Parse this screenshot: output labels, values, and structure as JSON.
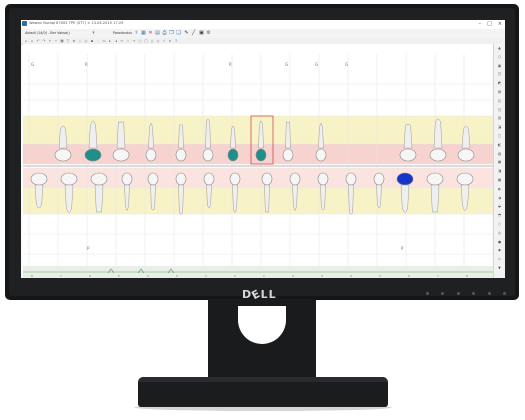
{
  "app": {
    "title": "Wawan Nuraqi 87005 TPE (ST7) × 13.04.2015 17:29",
    "window_controls": [
      "–",
      "□",
      "×"
    ]
  },
  "toolbar": {
    "patient_field": "Abiadi (14/0) - Ber Vaksa()",
    "mode_field": "Parodontus"
  },
  "chart": {
    "quadrant_markers_top": [
      "G",
      "R",
      "R",
      "G",
      "G",
      "G"
    ],
    "quadrant_markers_bottom": [
      "P",
      "P"
    ],
    "upper_row_numbers": [
      "8",
      "7",
      "6",
      "5",
      "4",
      "3",
      "2",
      "1",
      "1",
      "2",
      "3",
      "4",
      "5",
      "6",
      "7",
      "8"
    ],
    "lower_row_numbers": [
      "8",
      "7",
      "6",
      "5",
      "4",
      "3",
      "2",
      "1",
      "1",
      "2",
      "3",
      "4",
      "5",
      "6",
      "7",
      "8"
    ],
    "selected_tooth": "upper-3-left",
    "highlight_color_upper": "#f6d3cf",
    "highlight_color_lower": "#fbe3e0",
    "band_color": "#f7f3c7",
    "restoration_color": "#1f8f8a",
    "implant_color": "#1536c8"
  },
  "colors": {
    "accent": "#2f6da8"
  }
}
